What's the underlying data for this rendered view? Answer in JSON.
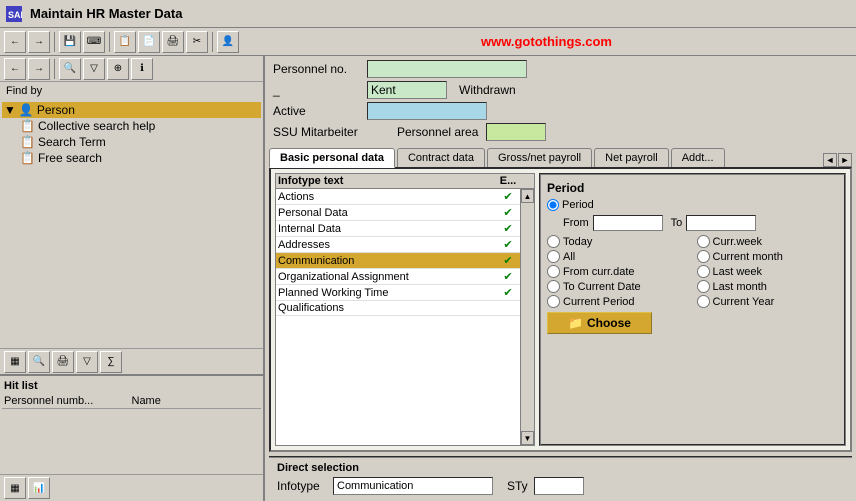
{
  "titleBar": {
    "icon": "SAP",
    "title": "Maintain HR Master Data"
  },
  "website": "www.gotothings.com",
  "toolbar": {
    "buttons": [
      "←",
      "→",
      "⟳",
      "📋",
      "📄",
      "🖨",
      "✂",
      "👤"
    ]
  },
  "leftPanel": {
    "findBy": "Find by",
    "treeItems": [
      {
        "label": "Person",
        "level": 0,
        "selected": true
      },
      {
        "label": "Collective search help",
        "level": 1
      },
      {
        "label": "Search Term",
        "level": 1
      },
      {
        "label": "Free search",
        "level": 1
      }
    ],
    "hitList": {
      "title": "Hit list",
      "columns": [
        "Personnel numb...",
        "Name"
      ]
    }
  },
  "topSection": {
    "personnelLabel": "Personnel no.",
    "personnelValue": "",
    "nameLabel": "_",
    "nameValue": "Kent",
    "statusValue": "Withdrawn",
    "activeLabel": "Active",
    "activeValue": "",
    "ssuLabel": "SSU Mitarbeiter",
    "personnelAreaLabel": "Personnel area",
    "personnelAreaValue": ""
  },
  "tabs": [
    {
      "label": "Basic personal data",
      "active": true
    },
    {
      "label": "Contract data",
      "active": false
    },
    {
      "label": "Gross/net payroll",
      "active": false
    },
    {
      "label": "Net payroll",
      "active": false
    },
    {
      "label": "Addt...",
      "active": false
    }
  ],
  "infotypeTable": {
    "headers": [
      "Infotype text",
      "E..."
    ],
    "rows": [
      {
        "text": "Actions",
        "check": "✔",
        "selected": false
      },
      {
        "text": "Personal Data",
        "check": "✔",
        "selected": false
      },
      {
        "text": "Internal Data",
        "check": "✔",
        "selected": false
      },
      {
        "text": "Addresses",
        "check": "✔",
        "selected": false
      },
      {
        "text": "Communication",
        "check": "✔",
        "selected": true
      },
      {
        "text": "Organizational Assignment",
        "check": "✔",
        "selected": false
      },
      {
        "text": "Planned Working Time",
        "check": "✔",
        "selected": false
      },
      {
        "text": "Qualifications",
        "check": "",
        "selected": false
      }
    ]
  },
  "period": {
    "title": "Period",
    "periodLabel": "Period",
    "fromLabel": "From",
    "fromValue": "",
    "toLabel": "To",
    "toValue": "",
    "options": [
      {
        "label": "Today",
        "name": "today"
      },
      {
        "label": "Curr.week",
        "name": "currweek"
      },
      {
        "label": "All",
        "name": "all"
      },
      {
        "label": "Current month",
        "name": "currentmonth"
      },
      {
        "label": "From curr.date",
        "name": "fromcurrdate"
      },
      {
        "label": "Last week",
        "name": "lastweek"
      },
      {
        "label": "To Current Date",
        "name": "tocurrentdate"
      },
      {
        "label": "Last month",
        "name": "lastmonth"
      },
      {
        "label": "Current Period",
        "name": "currentperiod"
      },
      {
        "label": "Current Year",
        "name": "currentyear"
      }
    ],
    "chooseLabel": "Choose"
  },
  "directSelection": {
    "title": "Direct selection",
    "infotypeLabel": "Infotype",
    "infotypeValue": "Communication",
    "styLabel": "STy",
    "styValue": ""
  }
}
